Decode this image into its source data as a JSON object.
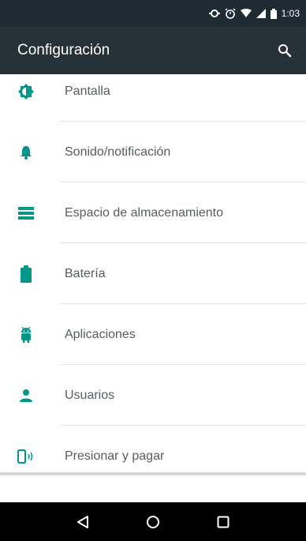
{
  "status_bar": {
    "time": "1:03"
  },
  "app_bar": {
    "title": "Configuración"
  },
  "settings": {
    "items": [
      {
        "label": "Pantalla",
        "icon": "brightness-icon"
      },
      {
        "label": "Sonido/notificación",
        "icon": "bell-icon"
      },
      {
        "label": "Espacio de almacenamiento",
        "icon": "storage-icon"
      },
      {
        "label": "Batería",
        "icon": "battery-icon"
      },
      {
        "label": "Aplicaciones",
        "icon": "android-icon"
      },
      {
        "label": "Usuarios",
        "icon": "user-icon"
      },
      {
        "label": "Presionar y pagar",
        "icon": "tap-pay-icon"
      }
    ]
  },
  "colors": {
    "accent": "#009688",
    "app_bar": "#263238",
    "status_bar": "#1e2b33"
  }
}
